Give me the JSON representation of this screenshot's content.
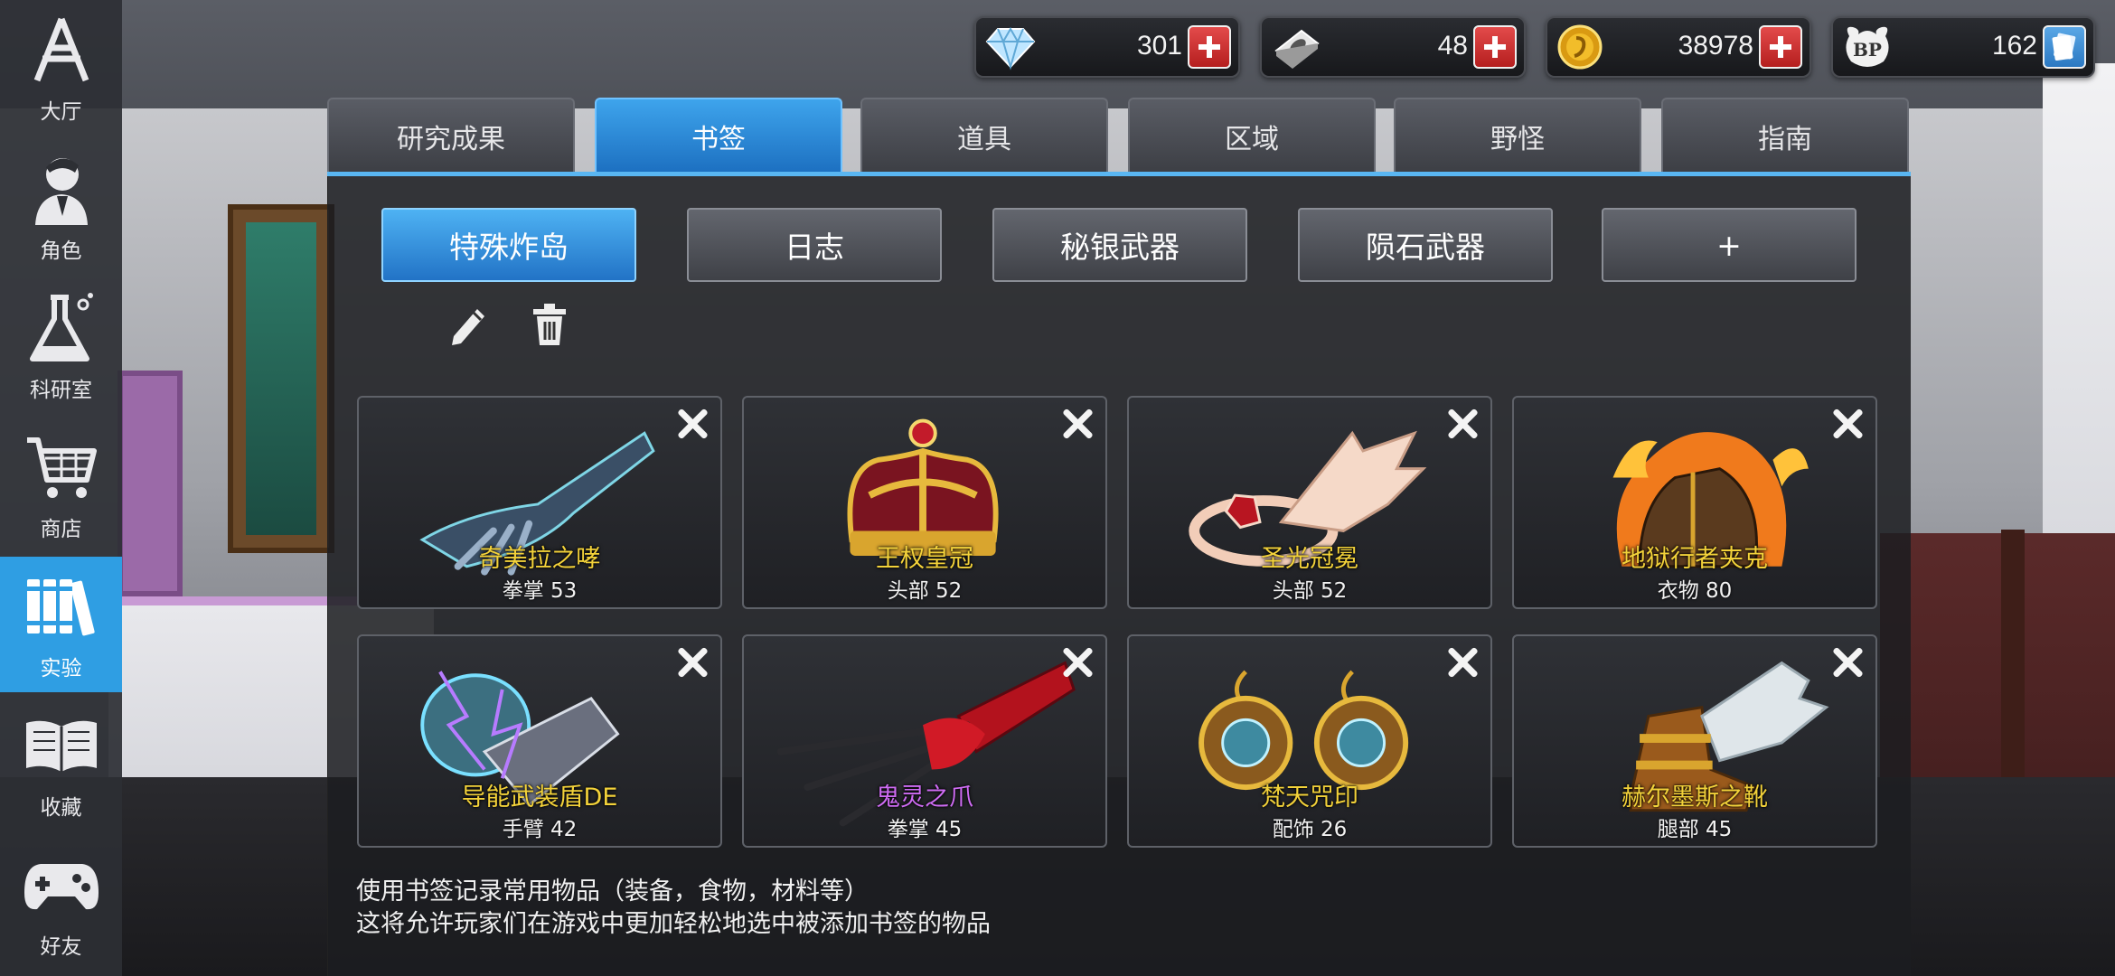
{
  "sidebar": {
    "items": [
      {
        "label": "大厅",
        "icon": "lobby-icon"
      },
      {
        "label": "角色",
        "icon": "character-icon"
      },
      {
        "label": "科研室",
        "icon": "flask-icon"
      },
      {
        "label": "商店",
        "icon": "cart-icon"
      },
      {
        "label": "实验",
        "icon": "books-icon",
        "active": true
      },
      {
        "label": "收藏",
        "icon": "open-book-icon"
      },
      {
        "label": "好友",
        "icon": "gamepad-icon"
      }
    ]
  },
  "currency": [
    {
      "icon": "diamond-icon",
      "value": "301",
      "action": "plus-icon"
    },
    {
      "icon": "device-icon",
      "value": "48",
      "action": "plus-icon"
    },
    {
      "icon": "gold-coin-icon",
      "value": "38978",
      "action": "plus-icon"
    },
    {
      "icon": "bp-icon",
      "icon_text": "BP",
      "value": "162",
      "action": "card-icon"
    }
  ],
  "tabs": [
    {
      "label": "研究成果"
    },
    {
      "label": "书签",
      "active": true
    },
    {
      "label": "道具"
    },
    {
      "label": "区域"
    },
    {
      "label": "野怪"
    },
    {
      "label": "指南"
    }
  ],
  "bookmark_groups": [
    {
      "label": "特殊炸岛",
      "active": true
    },
    {
      "label": "日志"
    },
    {
      "label": "秘银武器"
    },
    {
      "label": "陨石武器"
    },
    {
      "label": "+"
    }
  ],
  "items": [
    {
      "name": "奇美拉之哮",
      "slot": "拳掌 53",
      "icon": "claw-gauntlet-icon",
      "name_color": "yellow"
    },
    {
      "name": "王权皇冠",
      "slot": "头部 52",
      "icon": "crown-icon",
      "name_color": "yellow"
    },
    {
      "name": "圣光冠冕",
      "slot": "头部 52",
      "icon": "winged-circlet-icon",
      "name_color": "yellow"
    },
    {
      "name": "地狱行者夹克",
      "slot": "衣物 80",
      "icon": "flaming-jacket-icon",
      "name_color": "yellow"
    },
    {
      "name": "导能武装盾DE",
      "slot": "手臂 42",
      "icon": "lightning-shield-icon",
      "name_color": "yellow"
    },
    {
      "name": "鬼灵之爪",
      "slot": "拳掌 45",
      "icon": "red-claw-icon",
      "name_color": "purple"
    },
    {
      "name": "梵天咒印",
      "slot": "配饰 26",
      "icon": "earrings-icon",
      "name_color": "yellow"
    },
    {
      "name": "赫尔墨斯之靴",
      "slot": "腿部 45",
      "icon": "winged-boots-icon",
      "name_color": "yellow"
    }
  ],
  "hint": {
    "line1": "使用书签记录常用物品（装备，食物，材料等）",
    "line2": "这将允许玩家们在游戏中更加轻松地选中被添加书签的物品"
  },
  "colors": {
    "accent_blue": "#2f9ee3",
    "item_name_yellow": "#f3d23a",
    "item_name_purple": "#cf6cf4",
    "plus_red": "#c92a2a"
  }
}
